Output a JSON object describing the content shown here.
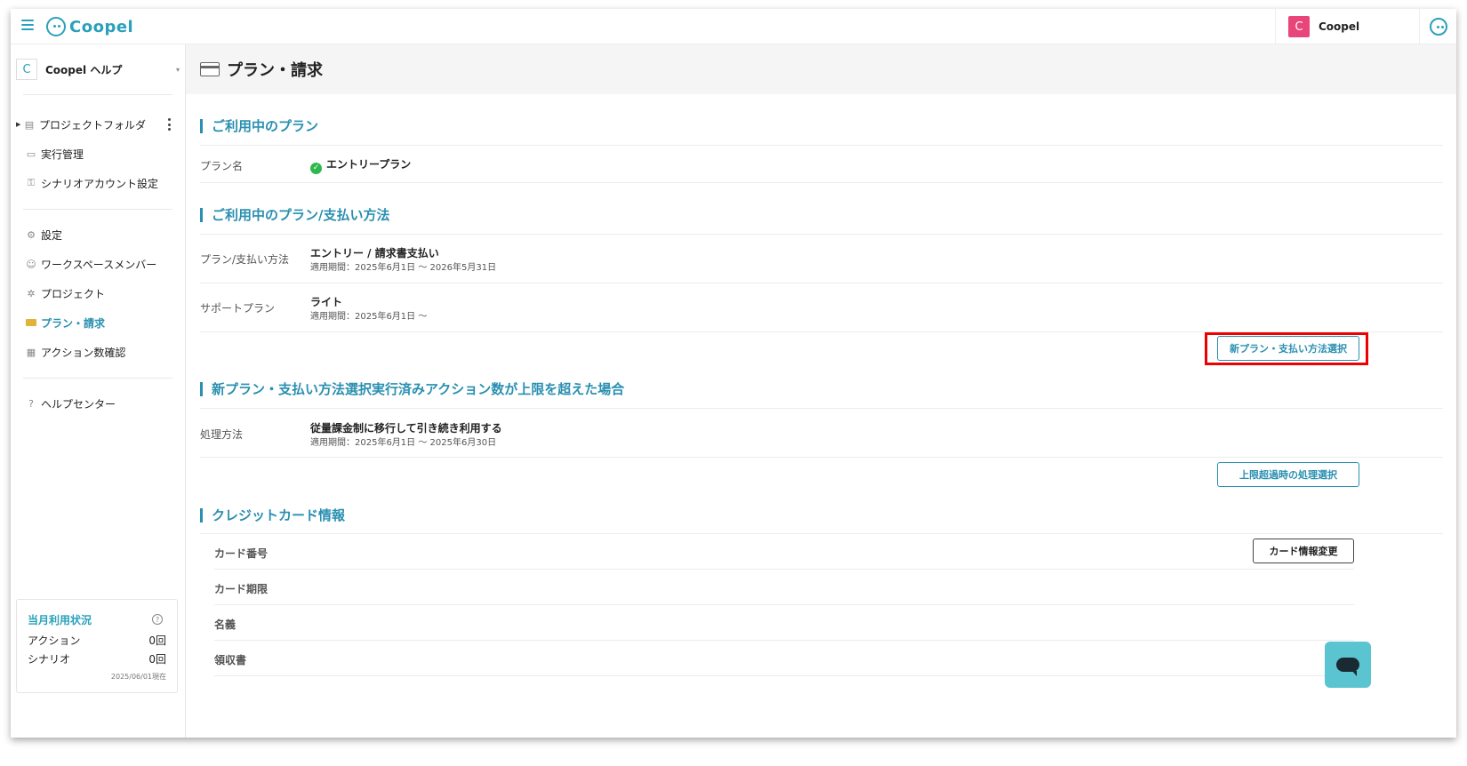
{
  "app": {
    "name": "Coopel"
  },
  "topbar": {
    "user_avatar_letter": "C",
    "user_name": "Coopel"
  },
  "workspace": {
    "avatar_letter": "C",
    "name": "Coopel ヘルプ"
  },
  "sidebar": {
    "items": [
      {
        "label": "プロジェクトフォルダ",
        "icon": "folder-icon"
      },
      {
        "label": "実行管理",
        "icon": "calendar-icon"
      },
      {
        "label": "シナリオアカウント設定",
        "icon": "account-lock-icon"
      },
      {
        "label": "設定",
        "icon": "gear-icon"
      },
      {
        "label": "ワークスペースメンバー",
        "icon": "members-icon"
      },
      {
        "label": "プロジェクト",
        "icon": "project-icon"
      },
      {
        "label": "プラン・請求",
        "icon": "credit-card-icon",
        "active": true
      },
      {
        "label": "アクション数確認",
        "icon": "calculator-icon"
      },
      {
        "label": "ヘルプセンター",
        "icon": "help-icon"
      }
    ],
    "usage": {
      "title": "当月利用状況",
      "rows": [
        {
          "label": "アクション",
          "value": "0回"
        },
        {
          "label": "シナリオ",
          "value": "0回"
        }
      ],
      "as_of": "2025/06/01現在"
    }
  },
  "page": {
    "title": "プラン・請求",
    "current_plan": {
      "section_title": "ご利用中のプラン",
      "plan_label": "プラン名",
      "plan_value": "エントリープラン"
    },
    "plan_payment": {
      "section_title": "ご利用中のプラン/支払い方法",
      "rows": [
        {
          "label": "プラン/支払い方法",
          "value": "エントリー / 請求書支払い",
          "sub": "適用期間：2025年6月1日 ～ 2026年5月31日"
        },
        {
          "label": "サポートプラン",
          "value": "ライト",
          "sub": "適用期間：2025年6月1日 ～"
        }
      ],
      "button": "新プラン・支払い方法選択"
    },
    "overflow": {
      "section_title": "新プラン・支払い方法選択実行済みアクション数が上限を超えた場合",
      "label": "処理方法",
      "value": "従量課金制に移行して引き続き利用する",
      "sub": "適用期間：2025年6月1日 ～ 2025年6月30日",
      "button": "上限超過時の処理選択"
    },
    "credit_card": {
      "section_title": "クレジットカード情報",
      "labels": [
        "カード番号",
        "カード期限",
        "名義",
        "領収書"
      ],
      "button": "カード情報変更"
    }
  },
  "colors": {
    "accent": "#2a8fb0",
    "brand": "#2aa1bb",
    "avatar": "#e8457a",
    "highlight": "#e00000",
    "chat": "#5bc4d1"
  }
}
